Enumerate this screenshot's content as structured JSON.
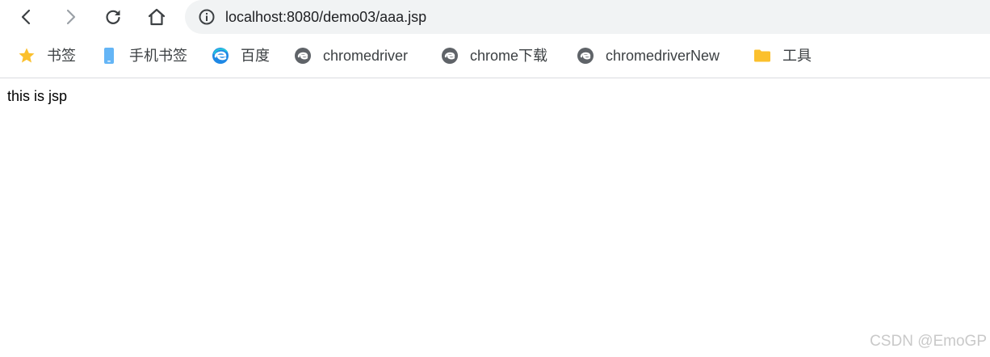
{
  "toolbar": {
    "url": "localhost:8080/demo03/aaa.jsp"
  },
  "bookmarks": [
    {
      "label": "书签",
      "icon": "star-icon"
    },
    {
      "label": "手机书签",
      "icon": "phone-icon"
    },
    {
      "label": "百度",
      "icon": "edge-icon"
    },
    {
      "label": "chromedriver",
      "icon": "site-icon"
    },
    {
      "label": "chrome下载",
      "icon": "site-icon"
    },
    {
      "label": "chromedriverNew",
      "icon": "site-icon"
    },
    {
      "label": "工具",
      "icon": "folder-icon"
    }
  ],
  "page": {
    "body_text": "this is jsp"
  },
  "watermark": "CSDN @EmoGP",
  "colors": {
    "omnibox_bg": "#f1f3f4",
    "star": "#fbc02d",
    "folder": "#fbc02d",
    "site_icon": "#5f6368",
    "phone": "#64b5f6"
  }
}
